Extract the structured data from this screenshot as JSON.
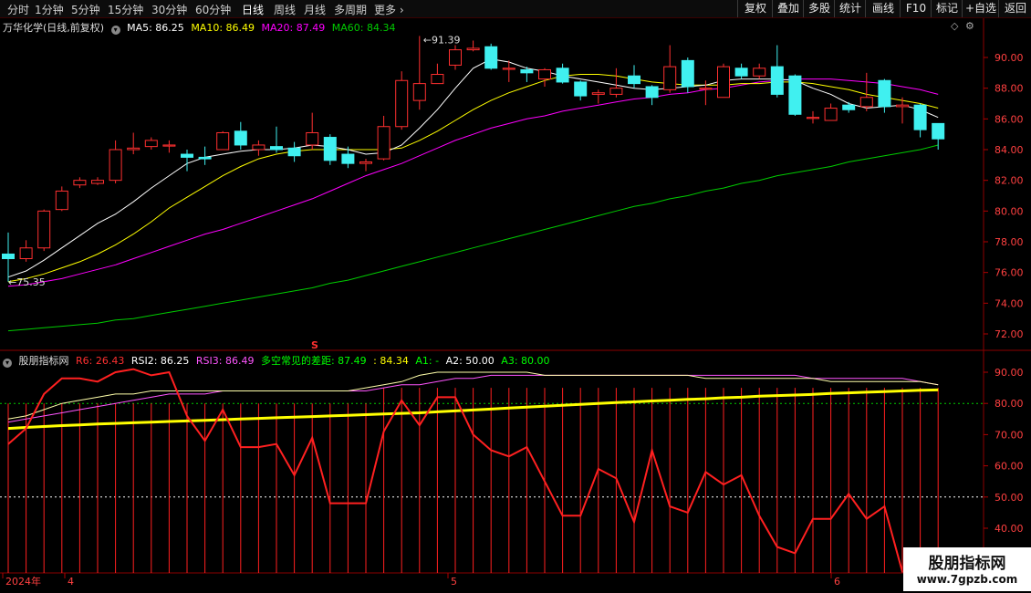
{
  "toolbar": {
    "tabs": [
      "分时",
      "1分钟",
      "5分钟",
      "15分钟",
      "30分钟",
      "60分钟",
      "日线",
      "周线",
      "月线",
      "多周期",
      "更多"
    ],
    "active_tab": "日线",
    "right_buttons": [
      "复权",
      "叠加",
      "多股",
      "统计",
      "画线",
      "F10",
      "标记",
      "+自选",
      "返回"
    ]
  },
  "main": {
    "stock_title": "万华化学(日线,前复权)",
    "ma_labels": [
      {
        "text": "MA5: 86.25",
        "color": "#ffffff"
      },
      {
        "text": "MA10: 86.49",
        "color": "#ffff00"
      },
      {
        "text": "MA20: 87.49",
        "color": "#ff00ff"
      },
      {
        "text": "MA60: 84.34",
        "color": "#00cc00"
      }
    ],
    "high_label": "91.39",
    "low_label": "75.35",
    "price_ticks": [
      "90.00",
      "88.00",
      "86.00",
      "84.00",
      "82.00",
      "80.00",
      "78.00",
      "76.00",
      "74.00",
      "72.00"
    ]
  },
  "indicator": {
    "title": "股朋指标网",
    "labels": [
      {
        "text": "R6: 26.43",
        "color": "#ff3030"
      },
      {
        "text": "RSI2: 86.25",
        "color": "#ffffff"
      },
      {
        "text": "RSI3: 86.49",
        "color": "#ff55ff"
      },
      {
        "text": "多空常见的差距: 87.49",
        "color": "#00ff00"
      },
      {
        "text": ": 84.34",
        "color": "#ffff00"
      },
      {
        "text": "A1: -",
        "color": "#00ff00"
      },
      {
        "text": "A2: 50.00",
        "color": "#ffffff"
      },
      {
        "text": "A3: 80.00",
        "color": "#00ff00"
      }
    ],
    "ticks": [
      "90.00",
      "80.00",
      "70.00",
      "60.00",
      "50.00",
      "40.00"
    ],
    "signal_mark": "S"
  },
  "xaxis": {
    "labels": [
      "2024年",
      "4",
      "5",
      "6"
    ]
  },
  "watermark": {
    "line1": "股朋指标网",
    "line2": "www.7gpzb.com"
  },
  "chart_data": {
    "type": "candlestick",
    "candles": [
      [
        77.2,
        76.9,
        78.6,
        75.4
      ],
      [
        76.9,
        77.6,
        78.1,
        76.7
      ],
      [
        77.6,
        80.0,
        80.1,
        77.4
      ],
      [
        80.1,
        81.3,
        81.6,
        80.0
      ],
      [
        81.7,
        82.0,
        82.2,
        81.5
      ],
      [
        81.8,
        82.0,
        82.2,
        81.7
      ],
      [
        82.0,
        84.0,
        84.6,
        81.8
      ],
      [
        84.0,
        84.1,
        85.1,
        83.7
      ],
      [
        84.2,
        84.6,
        84.8,
        84.0
      ],
      [
        84.3,
        84.3,
        84.6,
        83.8
      ],
      [
        83.7,
        83.5,
        84.0,
        82.6
      ],
      [
        83.5,
        83.4,
        84.2,
        83.0
      ],
      [
        84.0,
        85.1,
        85.2,
        84.0
      ],
      [
        85.2,
        84.3,
        85.8,
        84.0
      ],
      [
        84.0,
        84.3,
        84.6,
        83.6
      ],
      [
        84.2,
        84.0,
        85.5,
        83.8
      ],
      [
        84.1,
        83.6,
        84.5,
        83.2
      ],
      [
        84.3,
        85.1,
        86.4,
        84.0
      ],
      [
        84.8,
        83.3,
        85.0,
        83.0
      ],
      [
        83.7,
        83.1,
        84.2,
        82.8
      ],
      [
        83.1,
        83.2,
        83.4,
        82.6
      ],
      [
        83.4,
        85.5,
        86.2,
        83.3
      ],
      [
        85.5,
        88.5,
        89.1,
        85.3
      ],
      [
        87.2,
        88.3,
        91.4,
        86.6
      ],
      [
        88.3,
        88.9,
        89.6,
        88.6
      ],
      [
        89.5,
        90.5,
        90.8,
        89.2
      ],
      [
        90.5,
        90.6,
        91.1,
        90.4
      ],
      [
        90.7,
        89.3,
        90.9,
        89.2
      ],
      [
        89.3,
        89.3,
        89.8,
        88.4
      ],
      [
        89.2,
        89.0,
        89.4,
        88.4
      ],
      [
        88.6,
        89.2,
        89.3,
        88.1
      ],
      [
        89.3,
        88.4,
        89.6,
        88.3
      ],
      [
        88.4,
        87.5,
        88.5,
        87.2
      ],
      [
        87.6,
        87.7,
        87.9,
        87.0
      ],
      [
        87.6,
        88.0,
        89.3,
        87.4
      ],
      [
        88.8,
        88.3,
        89.5,
        88.0
      ],
      [
        88.1,
        87.4,
        88.2,
        86.9
      ],
      [
        87.9,
        89.4,
        90.8,
        87.7
      ],
      [
        89.8,
        88.1,
        90.0,
        87.7
      ],
      [
        88.0,
        88.0,
        88.5,
        86.9
      ],
      [
        87.4,
        89.4,
        89.6,
        87.4
      ],
      [
        89.3,
        88.8,
        89.6,
        88.6
      ],
      [
        88.8,
        89.3,
        89.6,
        88.6
      ],
      [
        89.4,
        87.6,
        90.8,
        87.4
      ],
      [
        88.8,
        86.3,
        88.9,
        86.2
      ],
      [
        86.1,
        86.1,
        86.5,
        85.7
      ],
      [
        85.9,
        86.7,
        87.0,
        85.9
      ],
      [
        86.9,
        86.6,
        87.1,
        86.4
      ],
      [
        86.8,
        87.4,
        89.0,
        86.5
      ],
      [
        88.5,
        86.8,
        88.6,
        86.4
      ],
      [
        86.8,
        86.9,
        87.4,
        85.7
      ],
      [
        86.9,
        85.3,
        87.0,
        84.8
      ],
      [
        85.7,
        84.7,
        85.7,
        84.0
      ]
    ],
    "ma5": [
      75.7,
      76.1,
      76.8,
      77.6,
      78.4,
      79.2,
      79.8,
      80.6,
      81.5,
      82.3,
      83.1,
      83.5,
      83.7,
      83.9,
      84.0,
      84.0,
      84.1,
      84.3,
      84.2,
      84.0,
      83.7,
      83.8,
      84.3,
      85.4,
      86.6,
      88.0,
      89.3,
      89.9,
      89.7,
      89.3,
      89.1,
      88.8,
      88.6,
      88.4,
      88.2,
      88.0,
      87.9,
      88.0,
      88.1,
      88.2,
      88.5,
      88.6,
      88.6,
      88.6,
      88.5,
      88.0,
      87.6,
      87.0,
      86.7,
      86.8,
      86.9,
      86.6,
      86.1
    ],
    "ma10": [
      75.4,
      75.6,
      75.9,
      76.3,
      76.7,
      77.2,
      77.8,
      78.5,
      79.3,
      80.2,
      80.9,
      81.6,
      82.3,
      82.9,
      83.4,
      83.7,
      83.9,
      84.0,
      84.0,
      84.0,
      84.0,
      84.0,
      84.1,
      84.6,
      85.2,
      85.9,
      86.6,
      87.2,
      87.7,
      88.1,
      88.5,
      88.8,
      88.9,
      88.9,
      88.8,
      88.6,
      88.4,
      88.3,
      88.2,
      88.2,
      88.2,
      88.3,
      88.3,
      88.4,
      88.4,
      88.3,
      88.1,
      87.9,
      87.6,
      87.4,
      87.2,
      87.0,
      86.7
    ],
    "ma20": [
      75.1,
      75.2,
      75.4,
      75.6,
      75.9,
      76.2,
      76.5,
      76.9,
      77.3,
      77.7,
      78.1,
      78.5,
      78.8,
      79.2,
      79.6,
      80.0,
      80.4,
      80.8,
      81.3,
      81.8,
      82.3,
      82.7,
      83.1,
      83.6,
      84.1,
      84.6,
      85.0,
      85.4,
      85.7,
      86.0,
      86.2,
      86.5,
      86.7,
      86.9,
      87.1,
      87.3,
      87.4,
      87.6,
      87.7,
      87.9,
      88.0,
      88.2,
      88.4,
      88.5,
      88.6,
      88.6,
      88.6,
      88.5,
      88.4,
      88.3,
      88.1,
      87.9,
      87.6
    ],
    "ma60": [
      72.2,
      72.3,
      72.4,
      72.5,
      72.6,
      72.7,
      72.9,
      73.0,
      73.2,
      73.4,
      73.6,
      73.8,
      74.0,
      74.2,
      74.4,
      74.6,
      74.8,
      75.0,
      75.3,
      75.5,
      75.8,
      76.1,
      76.4,
      76.7,
      77.0,
      77.3,
      77.6,
      77.9,
      78.2,
      78.5,
      78.8,
      79.1,
      79.4,
      79.7,
      80.0,
      80.3,
      80.5,
      80.8,
      81.0,
      81.3,
      81.5,
      81.8,
      82.0,
      82.3,
      82.5,
      82.7,
      82.9,
      83.2,
      83.4,
      83.6,
      83.8,
      84.0,
      84.3
    ],
    "r6": [
      67,
      72,
      83,
      88,
      88,
      87,
      90,
      91,
      89,
      90,
      76,
      68,
      78,
      66,
      66,
      67,
      57,
      69,
      48,
      48,
      48,
      71,
      81,
      73,
      82,
      82,
      70,
      65,
      63,
      66,
      55,
      44,
      44,
      59,
      56,
      42,
      65,
      47,
      45,
      58,
      54,
      57,
      44,
      34,
      32,
      43,
      43,
      51,
      43,
      47,
      26
    ],
    "rsi2": [
      75,
      76,
      78,
      80,
      81,
      82,
      83,
      83,
      84,
      84,
      84,
      84,
      84,
      84,
      84,
      84,
      84,
      84,
      84,
      84,
      85,
      86,
      87,
      89,
      90,
      90,
      90,
      90,
      90,
      90,
      89,
      89,
      89,
      89,
      89,
      89,
      89,
      89,
      89,
      88,
      88,
      88,
      88,
      88,
      88,
      88,
      87,
      87,
      87,
      87,
      87,
      87,
      86
    ],
    "rsi3": [
      74,
      75,
      76,
      77,
      78,
      79,
      80,
      81,
      82,
      83,
      83,
      83,
      84,
      84,
      84,
      84,
      84,
      84,
      84,
      84,
      84,
      85,
      86,
      86,
      87,
      88,
      88,
      89,
      89,
      89,
      89,
      89,
      89,
      89,
      89,
      89,
      89,
      89,
      89,
      89,
      89,
      89,
      89,
      89,
      89,
      88,
      88,
      88,
      88,
      88,
      88,
      87,
      86
    ],
    "yellow_line": [
      72.0,
      72.3,
      72.6,
      72.9,
      73.1,
      73.4,
      73.6,
      73.8,
      74.0,
      74.2,
      74.4,
      74.6,
      74.8,
      75.0,
      75.2,
      75.4,
      75.6,
      75.8,
      76.0,
      76.2,
      76.4,
      76.6,
      76.8,
      77.0,
      77.3,
      77.6,
      77.9,
      78.2,
      78.5,
      78.8,
      79.1,
      79.4,
      79.7,
      80.0,
      80.3,
      80.5,
      80.8,
      81.0,
      81.3,
      81.5,
      81.8,
      82.0,
      82.3,
      82.5,
      82.7,
      82.9,
      83.2,
      83.4,
      83.6,
      83.8,
      84.0,
      84.2,
      84.34
    ]
  }
}
